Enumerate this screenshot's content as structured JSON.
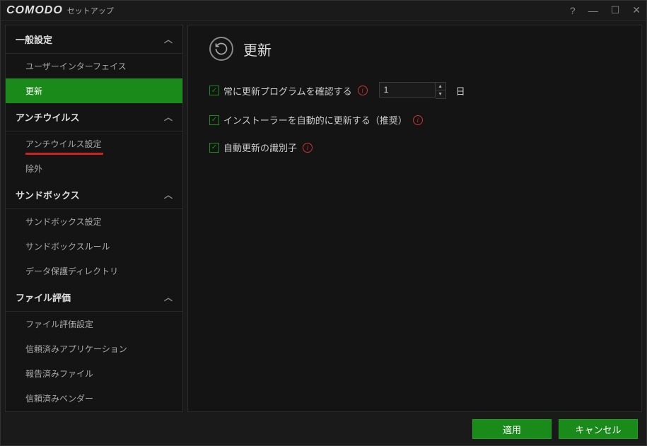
{
  "window": {
    "logo": "COMODO",
    "title": "セットアップ"
  },
  "sidebar": {
    "sections": [
      {
        "label": "一般設定",
        "items": [
          {
            "label": "ユーザーインターフェイス"
          },
          {
            "label": "更新"
          }
        ]
      },
      {
        "label": "アンチウイルス",
        "items": [
          {
            "label": "アンチウイルス設定"
          },
          {
            "label": "除外"
          }
        ]
      },
      {
        "label": "サンドボックス",
        "items": [
          {
            "label": "サンドボックス設定"
          },
          {
            "label": "サンドボックスルール"
          },
          {
            "label": "データ保護ディレクトリ"
          }
        ]
      },
      {
        "label": "ファイル評価",
        "items": [
          {
            "label": "ファイル評価設定"
          },
          {
            "label": "信頼済みアプリケーション"
          },
          {
            "label": "報告済みファイル"
          },
          {
            "label": "信頼済みベンダー"
          }
        ]
      }
    ]
  },
  "content": {
    "title": "更新",
    "settings": {
      "check_updates": {
        "label": "常に更新プログラムを確認する",
        "value": "1",
        "unit": "日"
      },
      "auto_update_installer": {
        "label": "インストーラーを自動的に更新する（推奨）"
      },
      "auto_update_identifier": {
        "label": "自動更新の識別子"
      }
    }
  },
  "footer": {
    "apply": "適用",
    "cancel": "キャンセル"
  }
}
